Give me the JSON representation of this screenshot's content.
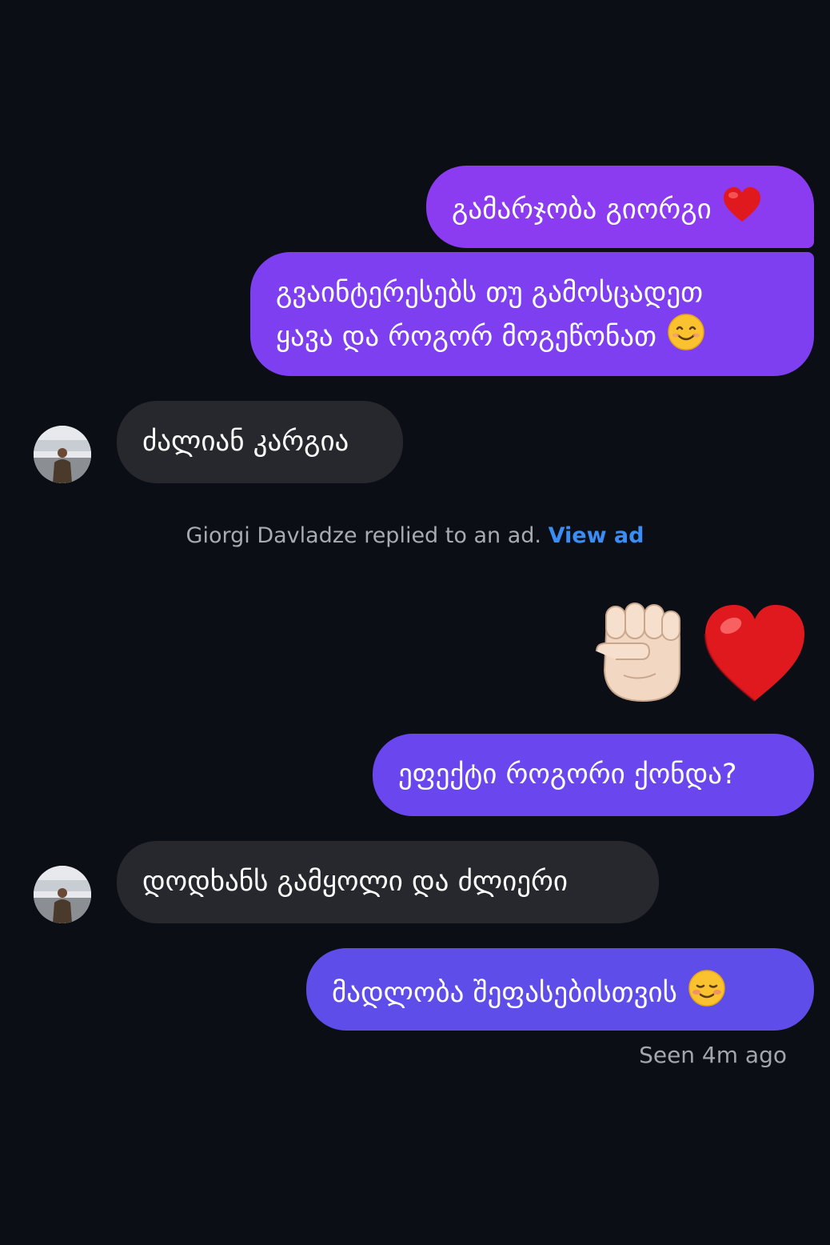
{
  "conversation": {
    "contact_name": "Giorgi Davladze",
    "messages": [
      {
        "from": "me",
        "lines": [
          "გამარჯობა გიორგი"
        ],
        "emoji": "red-heart"
      },
      {
        "from": "me",
        "lines": [
          "გვაინტერესებს თუ გამოსცადეთ",
          "ყავა და როგორ მოგეწონათ"
        ],
        "emoji": "smiling-face"
      },
      {
        "from": "them",
        "lines": [
          "ძალიან კარგია"
        ]
      },
      {
        "from": "me",
        "emoji_only": [
          "raised-fist",
          "red-heart"
        ]
      },
      {
        "from": "me",
        "lines": [
          "ეფექტი როგორი ქონდა?"
        ]
      },
      {
        "from": "them",
        "lines": [
          "დოდხანს გამყოლი და ძლიერი"
        ]
      },
      {
        "from": "me",
        "lines": [
          "მადლობა შეფასებისთვის"
        ],
        "emoji": "smiling-blush"
      }
    ],
    "ad_notice": {
      "text": "Giorgi Davladze replied to an ad.",
      "link": "View ad"
    },
    "seen_status": "Seen 4m ago"
  },
  "colors": {
    "background": "#0b0e14",
    "outgoing_bubble_top": "#8b3bf0",
    "outgoing_bubble_bottom": "#5f4de9",
    "incoming_bubble": "#26282d",
    "link": "#3b8cf3"
  }
}
